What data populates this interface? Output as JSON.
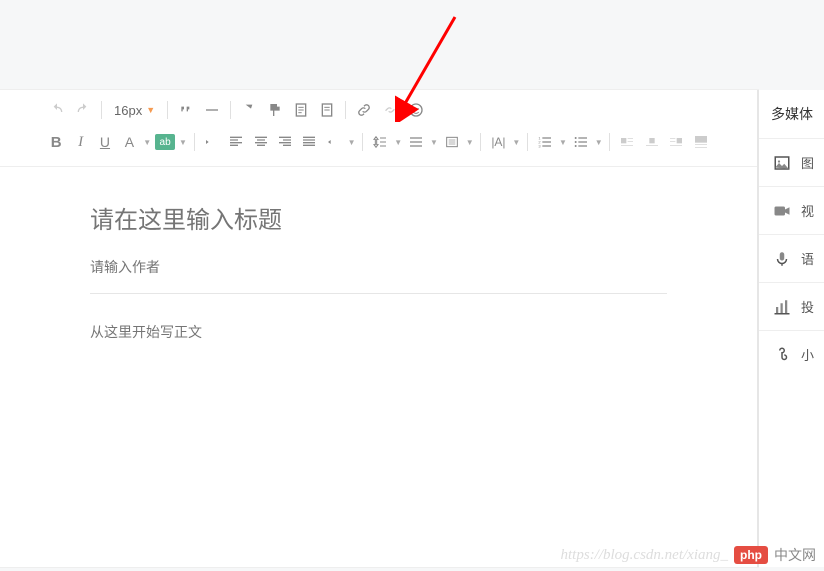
{
  "toolbar": {
    "fontsize": "16px",
    "bold": "B",
    "italic": "I",
    "underline": "U",
    "fontA": "A",
    "bgLabel": "ab"
  },
  "editor": {
    "title_placeholder": "请在这里输入标题",
    "author_placeholder": "请输入作者",
    "body_placeholder": "从这里开始写正文"
  },
  "sidebar": {
    "title": "多媒体",
    "items": [
      {
        "label": "图"
      },
      {
        "label": "视"
      },
      {
        "label": "语"
      },
      {
        "label": "投"
      },
      {
        "label": "小"
      }
    ]
  },
  "watermark": {
    "url": "https://blog.csdn.net/xiang_",
    "badge": "php",
    "suffix": "中文网"
  }
}
